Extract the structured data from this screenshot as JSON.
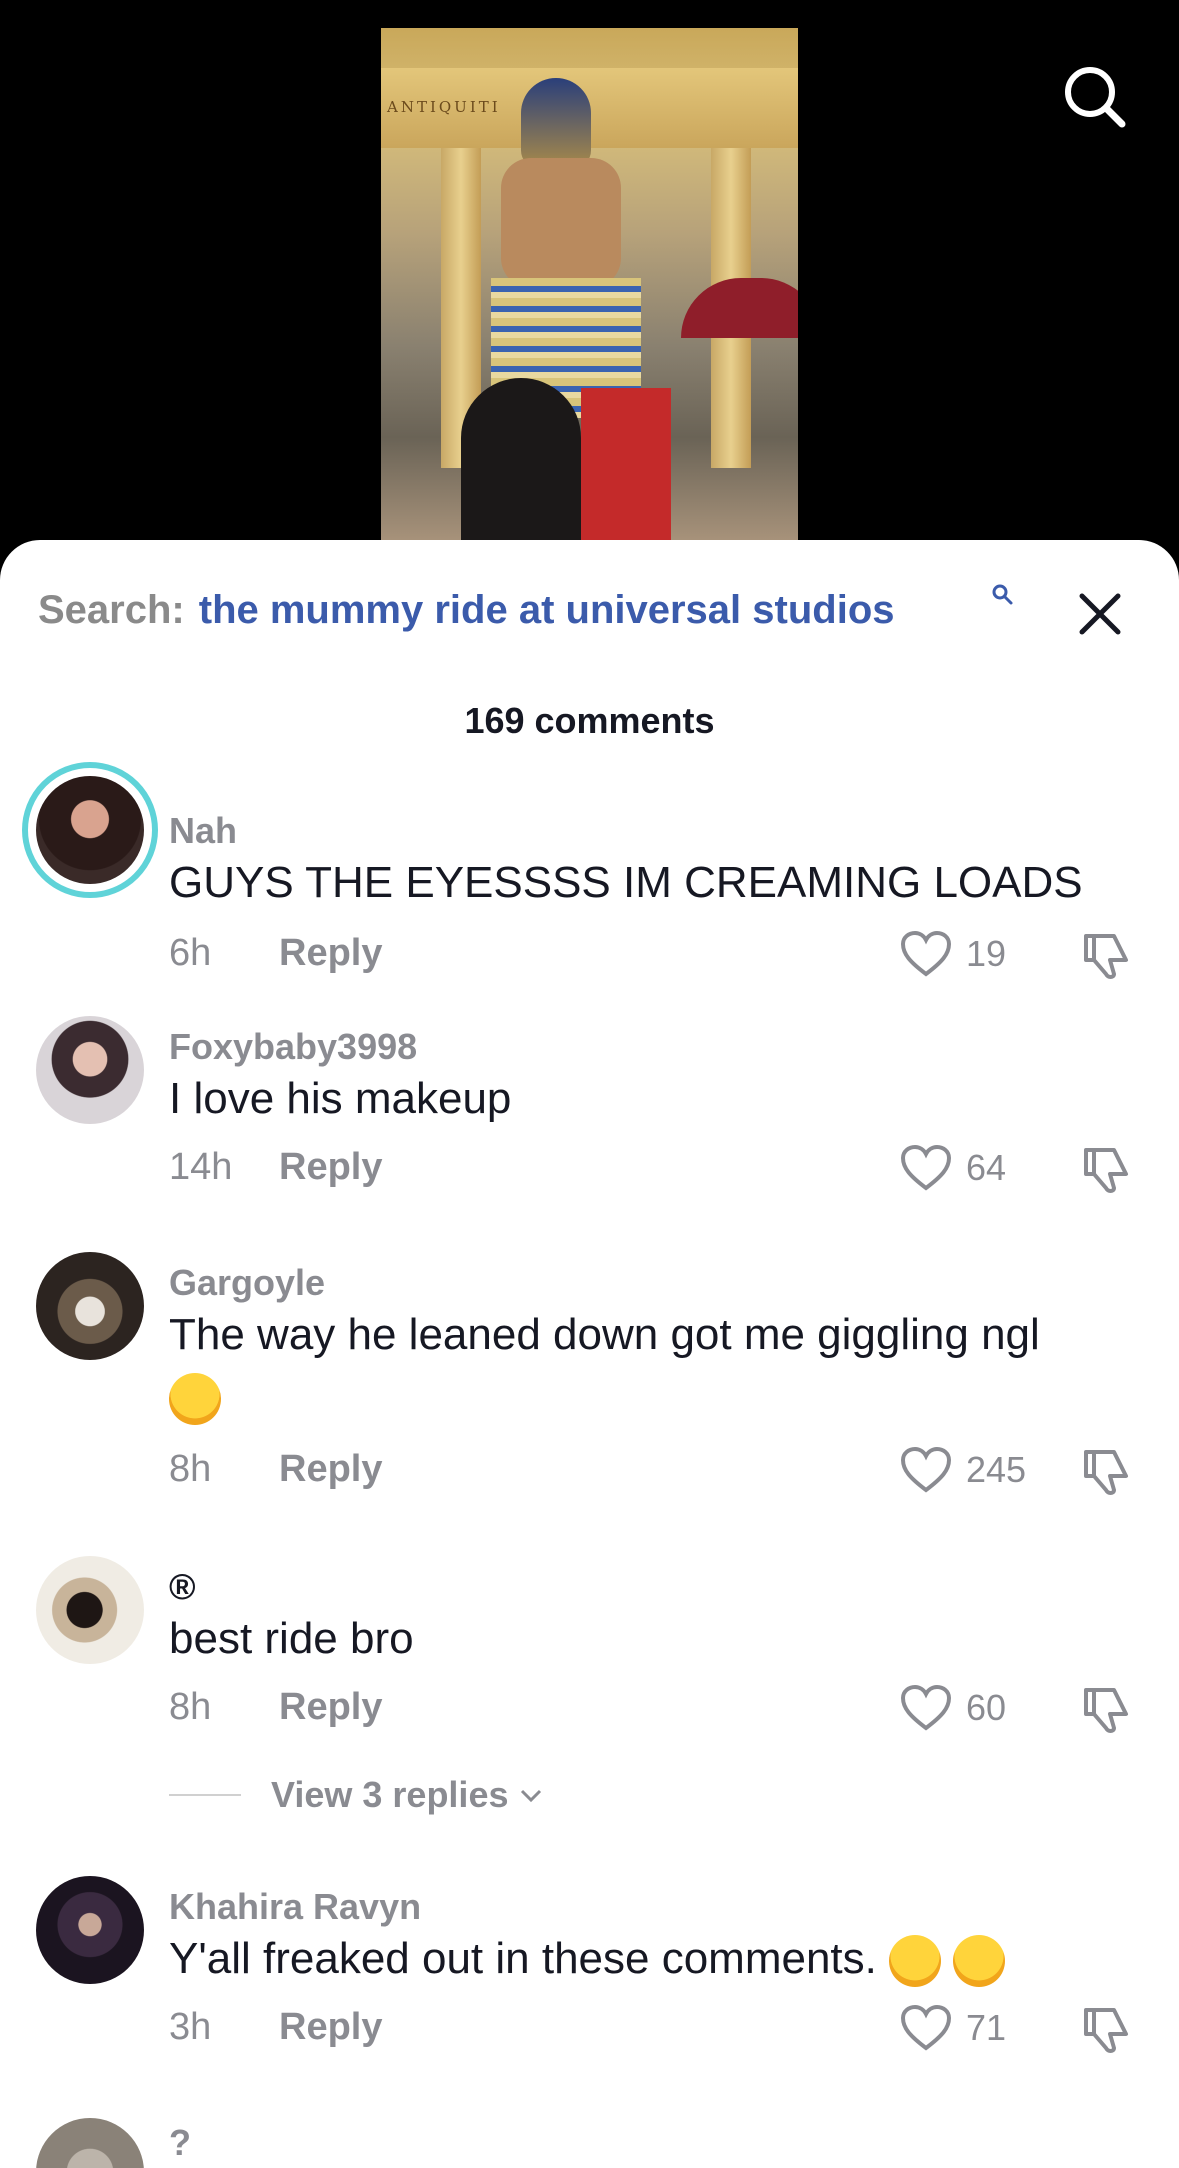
{
  "search": {
    "prefix": "Search:",
    "query": "the mummy ride at universal studios"
  },
  "comments_count": "169 comments",
  "video": {
    "sign_text": "ANTIQUITI"
  },
  "comments": [
    {
      "username": "Nah",
      "text": "GUYS THE EYESSSS IM CREAMING LOADS",
      "time": "6h",
      "reply": "Reply",
      "likes": "19"
    },
    {
      "username": "Foxybaby3998",
      "text": "I love his makeup",
      "time": "14h",
      "reply": "Reply",
      "likes": "64"
    },
    {
      "username": "Gargoyle",
      "text": "The way he leaned down got me giggling ngl",
      "time": "8h",
      "reply": "Reply",
      "likes": "245"
    },
    {
      "username": "®",
      "text": "best ride bro",
      "time": "8h",
      "reply": "Reply",
      "likes": "60",
      "view_replies": "View 3 replies"
    },
    {
      "username": "Khahira Ravyn",
      "text": "Y'all freaked out in these comments.",
      "time": "3h",
      "reply": "Reply",
      "likes": "71"
    },
    {
      "username": "?"
    }
  ],
  "colors": {
    "accent_blue": "#3b5bab",
    "ring": "#5fd3d8",
    "muted": "#8a8b91",
    "text": "#161823"
  }
}
